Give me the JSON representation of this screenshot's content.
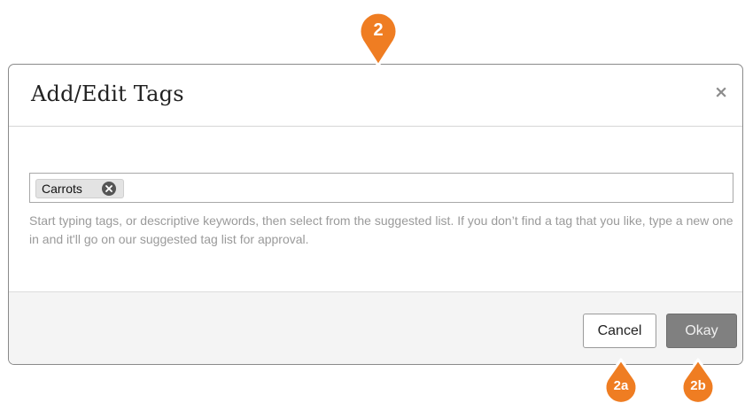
{
  "dialog": {
    "title": "Add/Edit Tags",
    "close_label": "×"
  },
  "tag_field": {
    "tags": [
      {
        "label": "Carrots",
        "remove_icon": "x-circle-icon"
      }
    ],
    "help_text": "Start typing tags, or descriptive keywords, then select from the suggested list. If you don’t find a tag that you like, type a new one in and it'll go on our suggested tag list for approval."
  },
  "footer": {
    "cancel_label": "Cancel",
    "okay_label": "Okay"
  },
  "callouts": [
    {
      "label": "2"
    },
    {
      "label": "2a"
    },
    {
      "label": "2b"
    }
  ],
  "colors": {
    "callout_orange": "#ef7d22",
    "okay_button": "#808080"
  }
}
